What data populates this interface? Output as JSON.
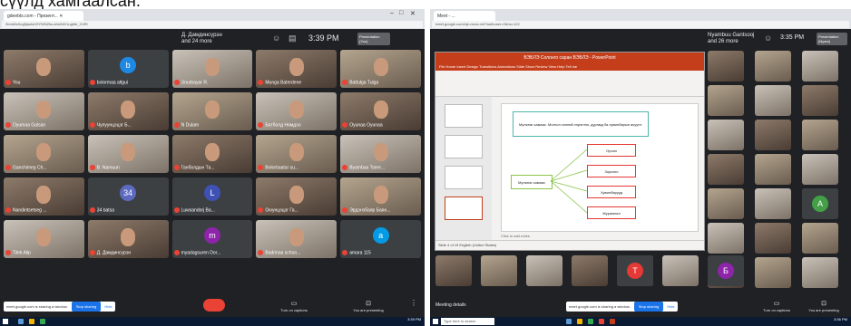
{
  "caption": "сүүлд хамгаалсан.",
  "left": {
    "tab_title": "gdeebts.com - Презент... ✕",
    "address": "2bmk0c0ug5jaolw19YWN2tw-ahn04K1ughfe_ChRl",
    "header_names": "Д. Дамдинсүрэн\nand 24 more",
    "time": "3:39 PM",
    "presentation_badge": "Presentation (You)",
    "participants": [
      {
        "name": "You",
        "avatar": "",
        "color": ""
      },
      {
        "name": "bolormaa altgui",
        "avatar": "b",
        "color": "#1e88e5"
      },
      {
        "name": "Unurbayar R.",
        "avatar": "",
        "color": ""
      },
      {
        "name": "Munga Baterdene",
        "avatar": "",
        "color": ""
      },
      {
        "name": "Battulga Tulga",
        "avatar": "",
        "color": ""
      },
      {
        "name": "Oyumaa Galsan",
        "avatar": "",
        "color": ""
      },
      {
        "name": "Чулуунцэцэг Б...",
        "avatar": "",
        "color": ""
      },
      {
        "name": "N Dulam",
        "avatar": "",
        "color": ""
      },
      {
        "name": "Батболд Нямдоо",
        "avatar": "",
        "color": ""
      },
      {
        "name": "Oyunaa Oyunaa",
        "avatar": "",
        "color": ""
      },
      {
        "name": "Ganchimeg Ch...",
        "avatar": "",
        "color": ""
      },
      {
        "name": "B. Namuun",
        "avatar": "",
        "color": ""
      },
      {
        "name": "Ганболдын Та...",
        "avatar": "",
        "color": ""
      },
      {
        "name": "Bolorbaatar su...",
        "avatar": "",
        "color": ""
      },
      {
        "name": "Byambaa Tsere...",
        "avatar": "",
        "color": ""
      },
      {
        "name": "Nandintsetseg ...",
        "avatar": "",
        "color": ""
      },
      {
        "name": "34 batsa",
        "avatar": "34",
        "color": "#5c6bc0"
      },
      {
        "name": "Luwsandorj Ba...",
        "avatar": "L",
        "color": "#3f51b5"
      },
      {
        "name": "Оюунцэцэг Га...",
        "avatar": "",
        "color": ""
      },
      {
        "name": "Эрдэнэбаяр Баян...",
        "avatar": "",
        "color": ""
      },
      {
        "name": "Tilek Alip",
        "avatar": "",
        "color": ""
      },
      {
        "name": "Д. Дамдинсүрэн",
        "avatar": "",
        "color": ""
      },
      {
        "name": "myadagsuren Dor...",
        "avatar": "m",
        "color": "#8e24aa"
      },
      {
        "name": "Badrinaa schoo...",
        "avatar": "",
        "color": ""
      },
      {
        "name": "amara 115",
        "avatar": "a",
        "color": "#039be5"
      }
    ],
    "share_text": "meet.google.com is sharing a window.",
    "stop_sharing": "Stop sharing",
    "hide": "Hide",
    "captions_label": "Turn on captions",
    "presenting_label": "You are presenting",
    "taskbar_time": "3:39 PM"
  },
  "right": {
    "tab_title": "Meet - ...",
    "address": "meet.google.com/cje-nsvw-rmf?authuser=0&hs=122",
    "header_names": "Nyambuu Gantsooj\nand 26 more",
    "time": "3:35 PM",
    "presentation_badge": "Presentation (Nyam)",
    "ppt": {
      "title": "ВЭБЛЭ Солонго саран ВЭБЛЭ - PowerPoint",
      "menu": "File   Home   Insert   Design   Transitions   Animations   Slide Show   Review   View   Help   Tell me",
      "question": "Мультик чамаас. Монгол хэлний хэрэглээ, дүрэмд ба хувилбарын асуулт.",
      "center": "Мультик чамаас",
      "options": [
        "Орчин",
        "Зорилго",
        "Хувилбарууд",
        "Журамлал"
      ],
      "status": "Slide 4 of 15    English (United States)",
      "notes": "Click to add notes"
    },
    "meeting_details": "Meeting details",
    "share_text": "meet.google.com is sharing a window.",
    "stop_sharing": "Stop sharing",
    "hide": "Hide",
    "captions_label": "Turn on captions",
    "presenting_label": "You are presenting",
    "search_placeholder": "Type here to search",
    "taskbar_time": "3:36 PM",
    "side_avatars": [
      {
        "letter": "T",
        "color": "#e53935"
      },
      {
        "letter": "Б",
        "color": "#8e24aa"
      },
      {
        "letter": "A",
        "color": "#43a047"
      }
    ]
  }
}
